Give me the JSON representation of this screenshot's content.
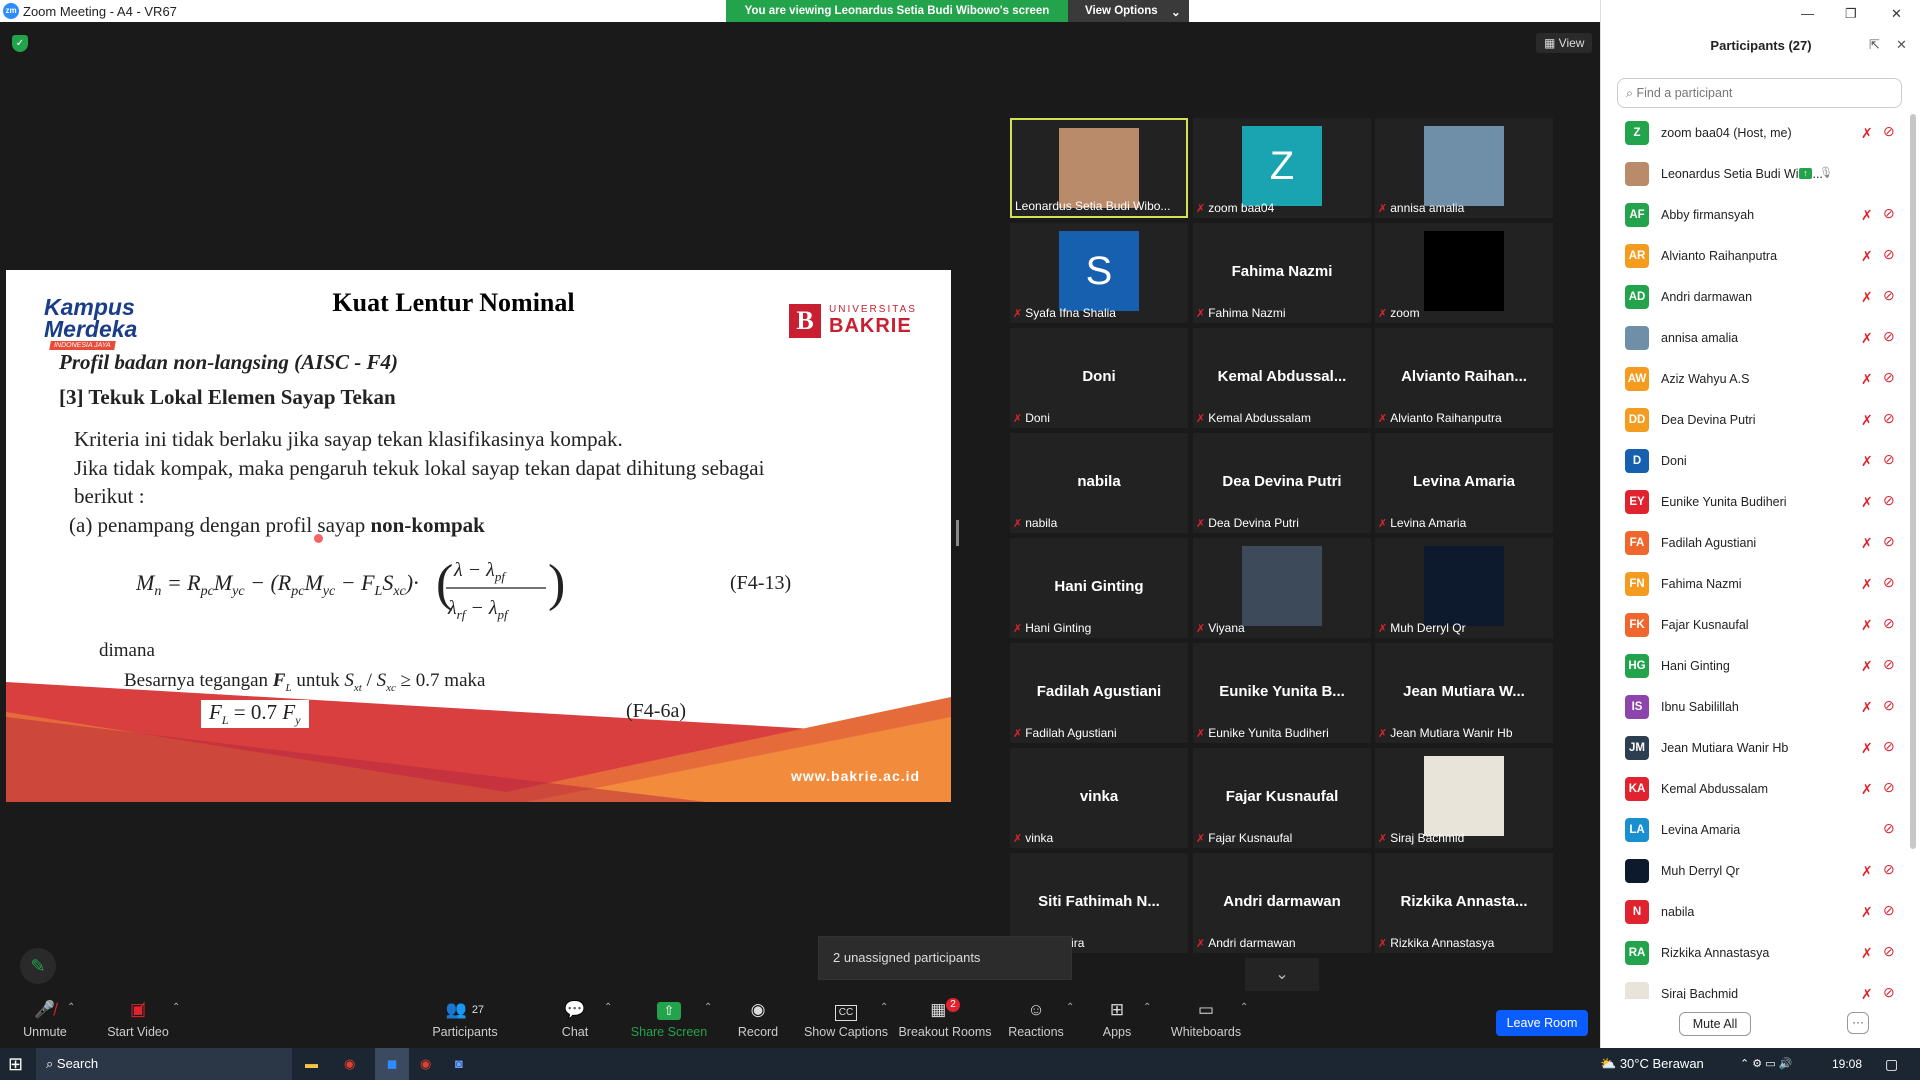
{
  "window": {
    "title": "Zoom Meeting - A4 - VR67",
    "app_icon": "zm"
  },
  "banner": {
    "message": "You are viewing Leonardus Setia Budi Wibowo's screen",
    "view_options": "View Options"
  },
  "view_button": "View",
  "slide": {
    "title": "Kuat Lentur Nominal",
    "logo_left_1": "Kampus",
    "logo_left_2": "Merdeka",
    "logo_left_3": "INDONESIA JAYA",
    "logo_right_1": "UNIVERSITAS",
    "logo_right_2": "BAKRIE",
    "logo_right_glyph": "B",
    "line1": "Profil badan non-langsing (AISC - F4)",
    "line2": "[3] Tekuk Lokal Elemen Sayap Tekan",
    "line3": "Kriteria ini tidak berlaku jika sayap tekan klasifikasinya kompak.",
    "line4": "Jika tidak kompak, maka pengaruh tekuk lokal sayap tekan dapat dihitung sebagai",
    "line5": "berikut :",
    "line6a": "(a) penampang dengan profil sayap ",
    "line6b": "non-kompak",
    "eq1_label": "(F4-13)",
    "dimana": "dimana",
    "besar": "Besarnya tegangan",
    "eq2_label": "(F4-6a)",
    "url": "www.bakrie.ac.id"
  },
  "tiles": [
    {
      "name": "",
      "label": "Leonardus Setia Budi Wibo...",
      "type": "photo",
      "avatar_color": "#b98b6a",
      "selected": true,
      "muted": false
    },
    {
      "name": "",
      "label": "zoom baa04",
      "type": "letter",
      "letter": "Z",
      "avatar_color": "#1aa3b0",
      "muted": true
    },
    {
      "name": "",
      "label": "annisa amalia",
      "type": "photo",
      "avatar_color": "#6f8fa8",
      "muted": true
    },
    {
      "name": "",
      "label": "Syafa Ifna Shalia",
      "type": "letter",
      "letter": "S",
      "avatar_color": "#1760b0",
      "muted": true
    },
    {
      "name": "Fahima Nazmi",
      "label": "Fahima Nazmi",
      "type": "name",
      "muted": true
    },
    {
      "name": "",
      "label": "zoom",
      "type": "photo",
      "avatar_color": "#000000",
      "muted": true
    },
    {
      "name": "Doni",
      "label": "Doni",
      "type": "name",
      "muted": true
    },
    {
      "name": "Kemal  Abdussal...",
      "label": "Kemal Abdussalam",
      "type": "name",
      "muted": true
    },
    {
      "name": "Alvianto  Raihan...",
      "label": "Alvianto Raihanputra",
      "type": "name",
      "muted": true
    },
    {
      "name": "nabila",
      "label": "nabila",
      "type": "name",
      "muted": true
    },
    {
      "name": "Dea Devina Putri",
      "label": "Dea Devina Putri",
      "type": "name",
      "muted": true
    },
    {
      "name": "Levina Amaria",
      "label": "Levina Amaria",
      "type": "name",
      "muted": true
    },
    {
      "name": "Hani Ginting",
      "label": "Hani Ginting",
      "type": "name",
      "muted": true
    },
    {
      "name": "",
      "label": "Viyana",
      "type": "photo",
      "avatar_color": "#3d4a5a",
      "muted": true
    },
    {
      "name": "",
      "label": "Muh Derryl Qr",
      "type": "photo",
      "avatar_color": "#0d1a2e",
      "muted": true
    },
    {
      "name": "Fadilah Agustiani",
      "label": "Fadilah Agustiani",
      "type": "name",
      "muted": true
    },
    {
      "name": "Eunike  Yunita  B...",
      "label": "Eunike Yunita Budiheri",
      "type": "name",
      "muted": true
    },
    {
      "name": "Jean  Mutiara  W...",
      "label": "Jean Mutiara Wanir Hb",
      "type": "name",
      "muted": true
    },
    {
      "name": "vinka",
      "label": "vinka",
      "type": "name",
      "muted": true
    },
    {
      "name": "Fajar Kusnaufal",
      "label": "Fajar Kusnaufal",
      "type": "name",
      "muted": true
    },
    {
      "name": "",
      "label": "Siraj Bachmid",
      "type": "photo",
      "avatar_color": "#e9e4da",
      "muted": true
    },
    {
      "name": "Siti  Fathimah  N...",
      "label": "imah Nadhira",
      "type": "name",
      "muted": false
    },
    {
      "name": "Andri darmawan",
      "label": "Andri darmawan",
      "type": "name",
      "muted": true
    },
    {
      "name": "Rizkika  Annasta...",
      "label": "Rizkika Annastasya",
      "type": "name",
      "muted": true
    }
  ],
  "unassigned": "2 unassigned participants",
  "toolbar": {
    "unmute": "Unmute",
    "start_video": "Start Video",
    "participants": "Participants",
    "participants_count": "27",
    "chat": "Chat",
    "share_screen": "Share Screen",
    "record": "Record",
    "show_captions": "Show Captions",
    "breakout_rooms": "Breakout Rooms",
    "breakout_badge": "2",
    "reactions": "Reactions",
    "apps": "Apps",
    "whiteboards": "Whiteboards",
    "leave_room": "Leave Room"
  },
  "panel": {
    "title": "Participants (27)",
    "search_placeholder": "Find a participant",
    "mute_all": "Mute All",
    "more": "···",
    "participants": [
      {
        "initials": "Z",
        "name": "zoom baa04 (Host, me)",
        "color": "#23a34b",
        "mic": true,
        "cam": true
      },
      {
        "initials": "",
        "name": "Leonardus Setia Budi Wibo...",
        "color": "#b98b6a",
        "photo": true,
        "sharing": true
      },
      {
        "initials": "AF",
        "name": "Abby firmansyah",
        "color": "#23a34b",
        "mic": true,
        "cam": true
      },
      {
        "initials": "AR",
        "name": "Alvianto Raihanputra",
        "color": "#f39c1f",
        "mic": true,
        "cam": true
      },
      {
        "initials": "AD",
        "name": "Andri darmawan",
        "color": "#23a34b",
        "mic": true,
        "cam": true
      },
      {
        "initials": "",
        "name": "annisa amalia",
        "color": "#6f8fa8",
        "photo": true,
        "mic": true,
        "cam": true
      },
      {
        "initials": "AW",
        "name": "Aziz Wahyu A.S",
        "color": "#f39c1f",
        "mic": true,
        "cam": true
      },
      {
        "initials": "DD",
        "name": "Dea Devina Putri",
        "color": "#f39c1f",
        "mic": true,
        "cam": true
      },
      {
        "initials": "D",
        "name": "Doni",
        "color": "#1760b0",
        "mic": true,
        "cam": true
      },
      {
        "initials": "EY",
        "name": "Eunike Yunita Budiheri",
        "color": "#e0232e",
        "mic": true,
        "cam": true
      },
      {
        "initials": "FA",
        "name": "Fadilah Agustiani",
        "color": "#f0672e",
        "mic": true,
        "cam": true
      },
      {
        "initials": "FN",
        "name": "Fahima Nazmi",
        "color": "#f39c1f",
        "mic": true,
        "cam": true
      },
      {
        "initials": "FK",
        "name": "Fajar Kusnaufal",
        "color": "#f0672e",
        "mic": true,
        "cam": true
      },
      {
        "initials": "HG",
        "name": "Hani Ginting",
        "color": "#23a34b",
        "mic": true,
        "cam": true
      },
      {
        "initials": "IS",
        "name": "Ibnu Sabilillah",
        "color": "#8e44ad",
        "mic": true,
        "cam": true
      },
      {
        "initials": "JM",
        "name": "Jean Mutiara Wanir Hb",
        "color": "#2c3e50",
        "mic": true,
        "cam": true
      },
      {
        "initials": "KA",
        "name": "Kemal Abdussalam",
        "color": "#e0232e",
        "mic": true,
        "cam": true
      },
      {
        "initials": "LA",
        "name": "Levina Amaria",
        "color": "#1a8fd0",
        "mic": false,
        "cam": true
      },
      {
        "initials": "",
        "name": "Muh Derryl Qr",
        "color": "#0d1a2e",
        "photo": true,
        "mic": true,
        "cam": true
      },
      {
        "initials": "N",
        "name": "nabila",
        "color": "#e0232e",
        "mic": true,
        "cam": true
      },
      {
        "initials": "RA",
        "name": "Rizkika Annastasya",
        "color": "#23a34b",
        "mic": true,
        "cam": true
      },
      {
        "initials": "",
        "name": "Siraj Bachmid",
        "color": "#e9e4da",
        "photo": true,
        "mic": true,
        "cam": true
      }
    ]
  },
  "taskbar": {
    "search": "Search",
    "weather": "30°C  Berawan",
    "time": "19:08"
  },
  "colors": {
    "accent": "#0b5cff",
    "green": "#23a34b",
    "muted_red": "#e0232e"
  }
}
